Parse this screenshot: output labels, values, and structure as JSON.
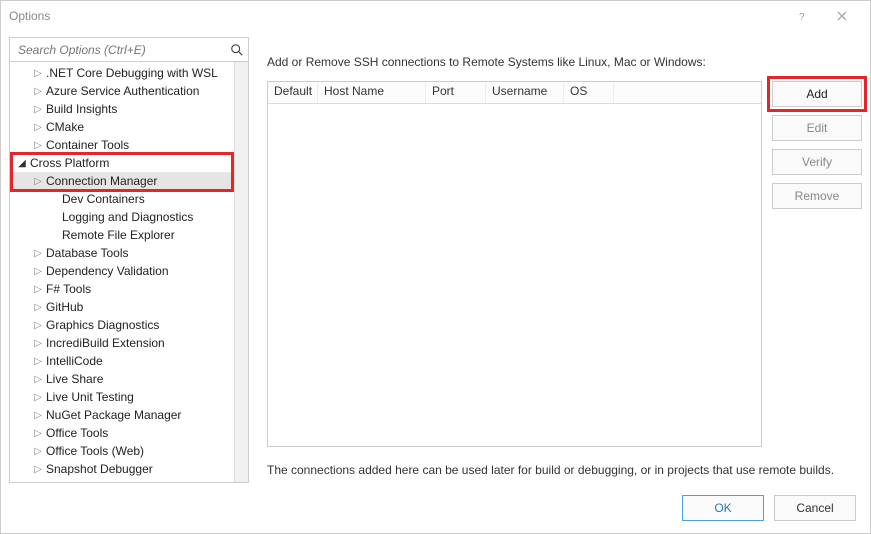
{
  "title": "Options",
  "search": {
    "placeholder": "Search Options (Ctrl+E)"
  },
  "tree": [
    {
      "label": ".NET Core Debugging with WSL",
      "indent": 1,
      "arrow": "right"
    },
    {
      "label": "Azure Service Authentication",
      "indent": 1,
      "arrow": "right"
    },
    {
      "label": "Build Insights",
      "indent": 1,
      "arrow": "right"
    },
    {
      "label": "CMake",
      "indent": 1,
      "arrow": "right"
    },
    {
      "label": "Container Tools",
      "indent": 1,
      "arrow": "right"
    },
    {
      "label": "Cross Platform",
      "indent": 0,
      "arrow": "down",
      "boxed": true
    },
    {
      "label": "Connection Manager",
      "indent": 1,
      "arrow": "right",
      "selected": true,
      "boxed": true
    },
    {
      "label": "Dev Containers",
      "indent": 2,
      "arrow": ""
    },
    {
      "label": "Logging and Diagnostics",
      "indent": 2,
      "arrow": ""
    },
    {
      "label": "Remote File Explorer",
      "indent": 2,
      "arrow": ""
    },
    {
      "label": "Database Tools",
      "indent": 1,
      "arrow": "right"
    },
    {
      "label": "Dependency Validation",
      "indent": 1,
      "arrow": "right"
    },
    {
      "label": "F# Tools",
      "indent": 1,
      "arrow": "right"
    },
    {
      "label": "GitHub",
      "indent": 1,
      "arrow": "right"
    },
    {
      "label": "Graphics Diagnostics",
      "indent": 1,
      "arrow": "right"
    },
    {
      "label": "IncrediBuild Extension",
      "indent": 1,
      "arrow": "right"
    },
    {
      "label": "IntelliCode",
      "indent": 1,
      "arrow": "right"
    },
    {
      "label": "Live Share",
      "indent": 1,
      "arrow": "right"
    },
    {
      "label": "Live Unit Testing",
      "indent": 1,
      "arrow": "right"
    },
    {
      "label": "NuGet Package Manager",
      "indent": 1,
      "arrow": "right"
    },
    {
      "label": "Office Tools",
      "indent": 1,
      "arrow": "right"
    },
    {
      "label": "Office Tools (Web)",
      "indent": 1,
      "arrow": "right"
    },
    {
      "label": "Snapshot Debugger",
      "indent": 1,
      "arrow": "right"
    }
  ],
  "right": {
    "description": "Add or Remove SSH connections to Remote Systems like Linux, Mac or Windows:",
    "columns": [
      "Default",
      "Host Name",
      "Port",
      "Username",
      "OS"
    ],
    "buttons": {
      "add": "Add",
      "edit": "Edit",
      "verify": "Verify",
      "remove": "Remove"
    },
    "note": "The connections added here can be used later for build or debugging, or in projects that use remote builds."
  },
  "footer": {
    "ok": "OK",
    "cancel": "Cancel"
  }
}
